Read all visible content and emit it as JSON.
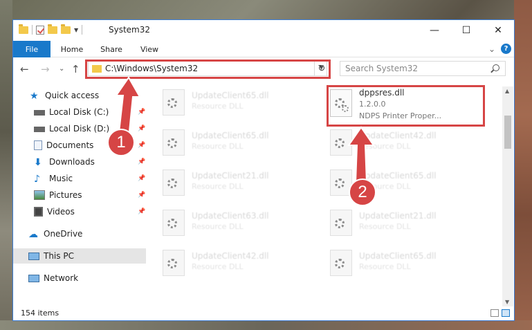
{
  "window": {
    "title": "System32",
    "minimize": "—",
    "maximize": "☐",
    "close": "✕"
  },
  "ribbon": {
    "tabs": [
      "File",
      "Home",
      "Share",
      "View"
    ],
    "expand": "⌄",
    "help": "?"
  },
  "nav": {
    "back": "←",
    "forward": "→",
    "recent": "⌄",
    "up": "↑",
    "address": "C:\\Windows\\System32",
    "refresh": "↻",
    "search_placeholder": "Search System32"
  },
  "sidebar": {
    "items": [
      {
        "label": "Quick access"
      },
      {
        "label": "Local Disk (C:)"
      },
      {
        "label": "Local Disk (D:)"
      },
      {
        "label": "Documents"
      },
      {
        "label": "Downloads"
      },
      {
        "label": "Music"
      },
      {
        "label": "Pictures"
      },
      {
        "label": "Videos"
      },
      {
        "label": "OneDrive"
      },
      {
        "label": "This PC"
      },
      {
        "label": "Network"
      }
    ]
  },
  "files": {
    "left": [
      {
        "name": "UpdateClient65.dll",
        "type": "Resource DLL"
      },
      {
        "name": "UpdateClient65.dll",
        "type": "Resource DLL"
      },
      {
        "name": "UpdateClient21.dll",
        "type": "Resource DLL"
      },
      {
        "name": "UpdateClient63.dll",
        "type": "Resource DLL"
      },
      {
        "name": "UpdateClient42.dll",
        "type": "Resource DLL"
      }
    ],
    "right": [
      {
        "name": "UpdateClient42.dll",
        "type": "Resource DLL"
      },
      {
        "name": "UpdateClient65.dll",
        "type": "Resource DLL"
      },
      {
        "name": "UpdateClient21.dll",
        "type": "Resource DLL"
      },
      {
        "name": "UpdateClient65.dll",
        "type": "Resource DLL"
      }
    ],
    "target": {
      "name": "dppsres.dll",
      "version": "1.2.0.0",
      "desc": "NDPS Printer Proper..."
    }
  },
  "status": {
    "count": "154 items"
  },
  "annotations": {
    "badge1": "1",
    "badge2": "2",
    "color": "#d64545"
  }
}
